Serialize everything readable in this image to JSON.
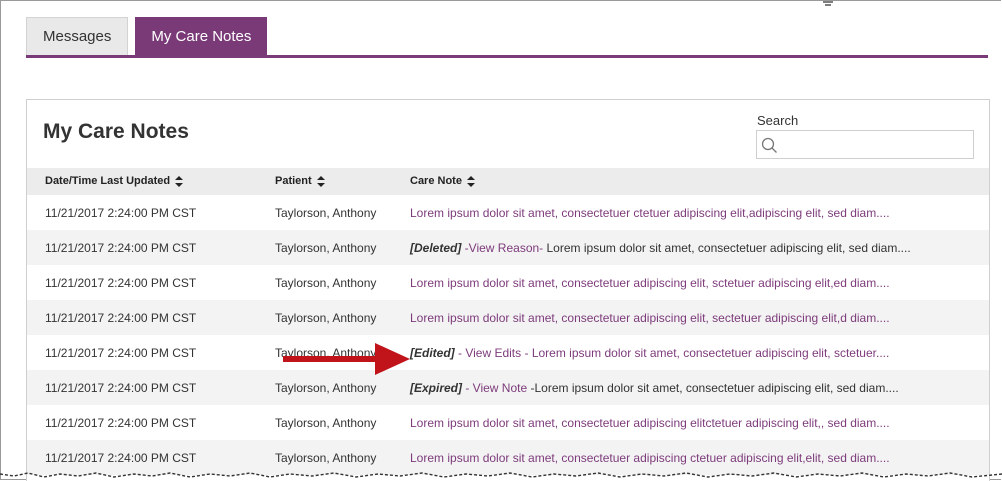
{
  "tabs": [
    {
      "label": "Messages",
      "active": false
    },
    {
      "label": "My Care Notes",
      "active": true
    }
  ],
  "card": {
    "title": "My Care Notes",
    "search": {
      "label": "Search",
      "value": "",
      "placeholder": ""
    }
  },
  "table": {
    "columns": [
      "Date/Time Last Updated",
      "Patient",
      "Care Note"
    ],
    "rows": [
      {
        "date": "11/21/2017 2:24:00 PM CST",
        "patient": "Taylorson, Anthony",
        "tag": "",
        "link": "",
        "note": "Lorem ipsum dolor sit amet, consectetuer ctetuer adipiscing elit,adipiscing elit, sed diam...."
      },
      {
        "date": "11/21/2017 2:24:00 PM CST",
        "patient": "Taylorson, Anthony",
        "tag": "[Deleted]",
        "link": " -View Reason-",
        "note": " Lorem ipsum dolor sit amet, consectetuer adipiscing elit, sed diam...."
      },
      {
        "date": "11/21/2017 2:24:00 PM CST",
        "patient": "Taylorson, Anthony",
        "tag": "",
        "link": "",
        "note": "Lorem ipsum dolor sit amet, consectetuer adipiscing elit, sctetuer adipiscing elit,ed diam...."
      },
      {
        "date": "11/21/2017 2:24:00 PM CST",
        "patient": "Taylorson, Anthony",
        "tag": "",
        "link": "",
        "note": "Lorem ipsum dolor sit amet, consectetuer adipiscing elit, sectetuer adipiscing elit,d diam...."
      },
      {
        "date": "11/21/2017 2:24:00 PM CST",
        "patient": "Taylorson, Anthony",
        "tag": "[Edited]",
        "link": " - View Edits -",
        "note": " Lorem ipsum dolor sit amet, consectetuer adipiscing elit, sctetuer...."
      },
      {
        "date": "11/21/2017 2:24:00 PM CST",
        "patient": "Taylorson, Anthony",
        "tag": "[Expired]",
        "link": " - View Note",
        "note": " -Lorem ipsum dolor sit amet, consectetuer adipiscing elit, sed diam...."
      },
      {
        "date": "11/21/2017 2:24:00 PM CST",
        "patient": "Taylorson, Anthony",
        "tag": "",
        "link": "",
        "note": "Lorem ipsum dolor sit amet, consectetuer adipiscing elitctetuer adipiscing elit,, sed diam...."
      },
      {
        "date": "11/21/2017 2:24:00 PM CST",
        "patient": "Taylorson, Anthony",
        "tag": "",
        "link": "",
        "note": "Lorem ipsum dolor sit amet, consectetuer adipiscing ctetuer adipiscing elit,elit, sed diam...."
      }
    ]
  },
  "icons": {
    "search": "search-icon",
    "sort": "sort-icon",
    "annotation": "red-arrow-icon"
  },
  "colors": {
    "accent": "#7a3a78",
    "link": "#7d3b7b",
    "header_bg": "#ececec",
    "arrow": "#c0141a"
  }
}
